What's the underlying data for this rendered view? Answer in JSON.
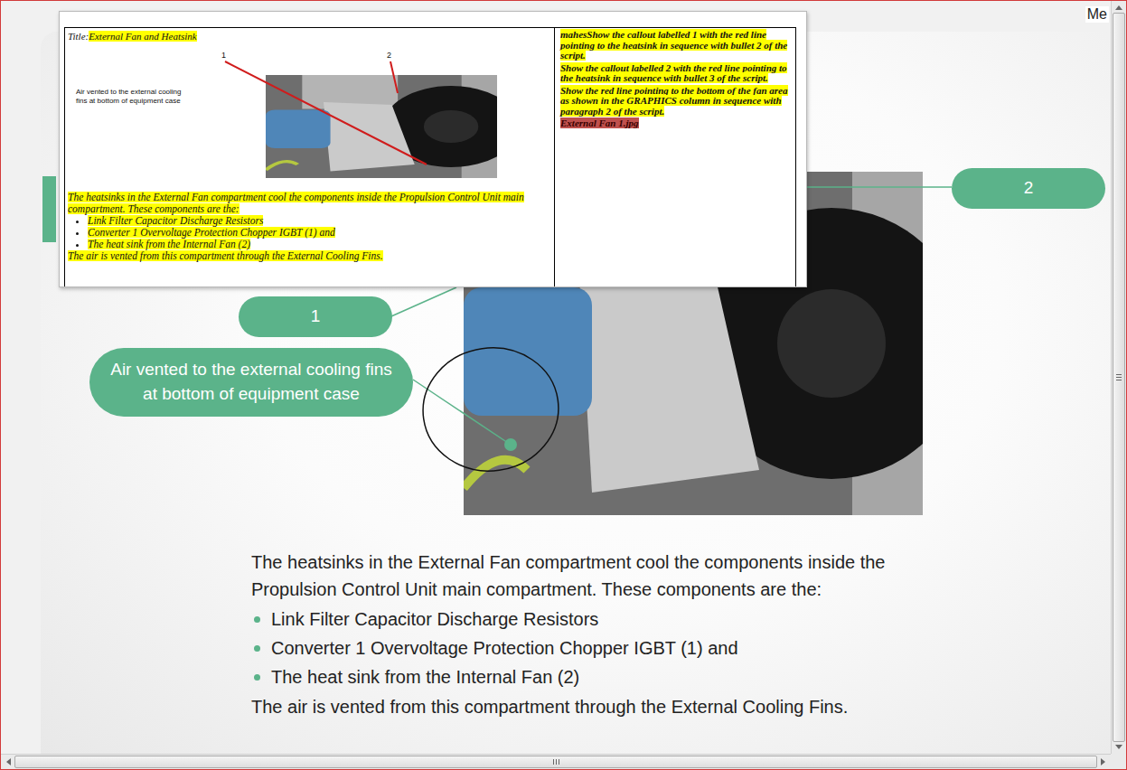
{
  "browser": {
    "corner_text": "Me"
  },
  "storyboard": {
    "title_label": "Title:",
    "title": "External Fan and Heatsink",
    "graphic": {
      "callouts": [
        "1",
        "2"
      ],
      "caption": "Air vented to the external cooling fins at bottom of equipment case"
    },
    "script": {
      "intro": "The heatsinks in the External Fan compartment cool the components inside the Propulsion Control Unit main compartment.  These components are the:",
      "bullets": [
        "Link Filter Capacitor Discharge Resistors",
        "Converter 1 Overvoltage Protection Chopper IGBT (1) and",
        "The heat sink  from the Internal Fan (2)"
      ],
      "closing": "The air is vented from this compartment through the External Cooling Fins."
    },
    "instructions": [
      "mahesShow the callout labelled 1 with the red line pointing to the heatsink in sequence with bullet 2 of the script.",
      "Show the callout labelled 2 with the red line pointing to the heatsink in sequence with bullet 3 of the script.",
      "Show the red line pointing to the bottom of the fan area as shown in the GRAPHICS column in sequence with paragraph 2 of the script."
    ],
    "file_name": "External Fan 1.jpg"
  },
  "slide": {
    "callouts": [
      {
        "label": "2"
      },
      {
        "label": "1"
      },
      {
        "label": "Air vented to the external cooling fins at bottom of equipment case"
      }
    ],
    "intro": "The heatsinks in the External Fan compartment cool the components inside the Propulsion Control Unit main compartment. These components are the:",
    "bullets": [
      "Link Filter Capacitor Discharge Resistors",
      "Converter 1 Overvoltage Protection Chopper IGBT (1) and",
      "The heat sink  from the Internal Fan (2)"
    ],
    "closing": "The air is vented from this compartment through the External Cooling Fins."
  }
}
